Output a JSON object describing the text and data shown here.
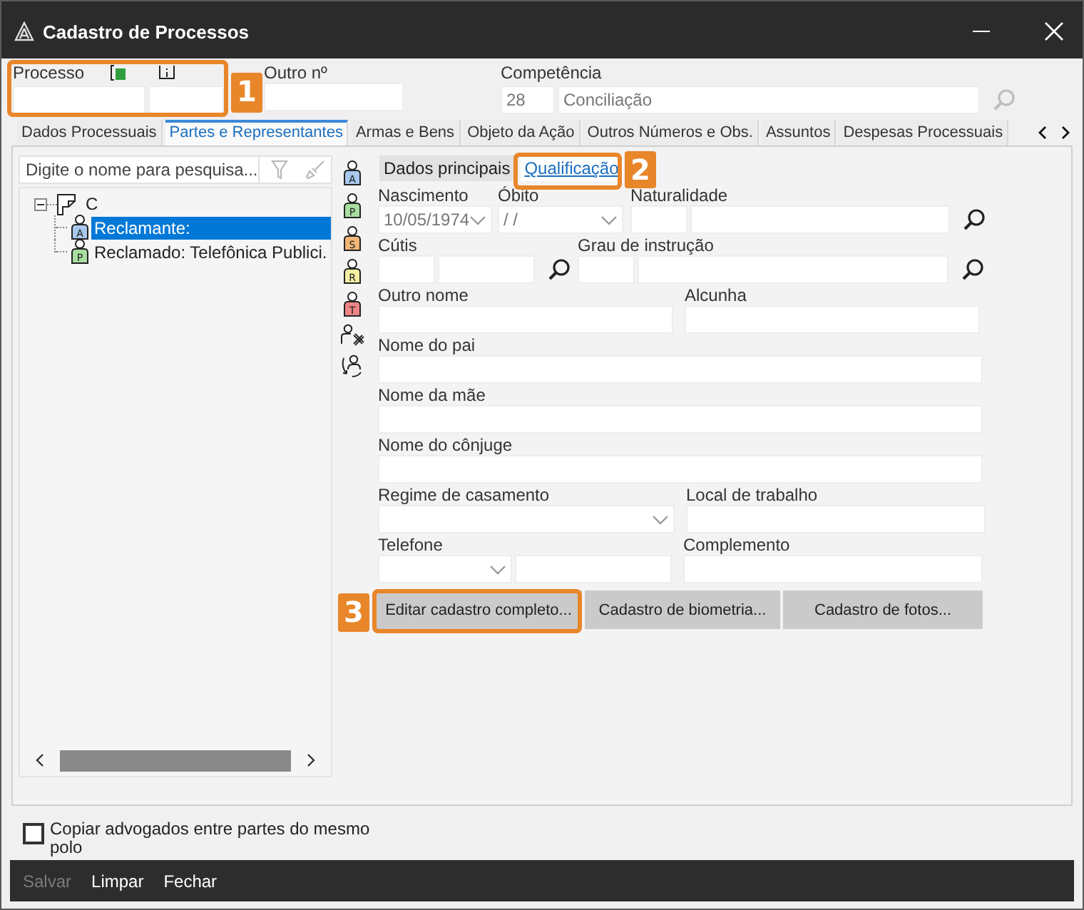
{
  "window": {
    "title": "Cadastro de Processos"
  },
  "header": {
    "processo": {
      "label": "Processo"
    },
    "outro_numero": {
      "label": "Outro nº"
    },
    "competencia": {
      "label": "Competência",
      "code": "28",
      "value": "Conciliação"
    }
  },
  "tabs": [
    {
      "label": "Dados Processuais",
      "selected": false
    },
    {
      "label": "Partes e Representantes",
      "selected": true
    },
    {
      "label": "Armas e Bens",
      "selected": false
    },
    {
      "label": "Objeto da Ação",
      "selected": false
    },
    {
      "label": "Outros Números e Obs.",
      "selected": false
    },
    {
      "label": "Assuntos",
      "selected": false
    },
    {
      "label": "Despesas Processuais",
      "selected": false
    }
  ],
  "search": {
    "placeholder": "Digite o nome para pesquisa..."
  },
  "tree": {
    "label": "C",
    "expanded": true,
    "children": [
      {
        "label": "Reclamante:",
        "letter": "A",
        "color": "#a9c8ee",
        "selected": true
      },
      {
        "label": "Reclamado: Telefônica Publici.",
        "letter": "P",
        "color": "#a8dfa0",
        "selected": false
      }
    ]
  },
  "side_tools": [
    {
      "kind": "person",
      "letter": "A",
      "color": "#a9c8ee"
    },
    {
      "kind": "person",
      "letter": "P",
      "color": "#a8dfa0"
    },
    {
      "kind": "person",
      "letter": "S",
      "color": "#f2b678"
    },
    {
      "kind": "person",
      "letter": "R",
      "color": "#f6efa4"
    },
    {
      "kind": "person",
      "letter": "T",
      "color": "#ee8585"
    },
    {
      "kind": "remove"
    },
    {
      "kind": "swap"
    }
  ],
  "subtabs": [
    {
      "label": "Dados principais",
      "selected": false
    },
    {
      "label": "Qualificação",
      "selected": true
    }
  ],
  "form": {
    "nascimento": {
      "label": "Nascimento",
      "value": "10/05/1974"
    },
    "obito": {
      "label": "Óbito",
      "value": "/ /"
    },
    "naturalidade": {
      "label": "Naturalidade"
    },
    "cutis": {
      "label": "Cútis"
    },
    "grau_instrucao": {
      "label": "Grau de instrução"
    },
    "outro_nome": {
      "label": "Outro nome"
    },
    "alcunha": {
      "label": "Alcunha"
    },
    "nome_pai": {
      "label": "Nome do pai"
    },
    "nome_mae": {
      "label": "Nome da mãe"
    },
    "nome_conjuge": {
      "label": "Nome do cônjuge"
    },
    "regime_casamento": {
      "label": "Regime de casamento"
    },
    "local_trabalho": {
      "label": "Local de trabalho"
    },
    "telefone": {
      "label": "Telefone"
    },
    "complemento": {
      "label": "Complemento"
    }
  },
  "buttons": [
    "Editar cadastro completo...",
    "Cadastro de biometria...",
    "Cadastro de fotos..."
  ],
  "copy_lawyers": {
    "label": "Copiar advogados entre partes do mesmo polo",
    "checked": false
  },
  "footer": [
    {
      "label": "Salvar",
      "disabled": true
    },
    {
      "label": "Limpar",
      "disabled": false
    },
    {
      "label": "Fechar",
      "disabled": false
    }
  ],
  "callouts": [
    "1",
    "2",
    "3"
  ]
}
